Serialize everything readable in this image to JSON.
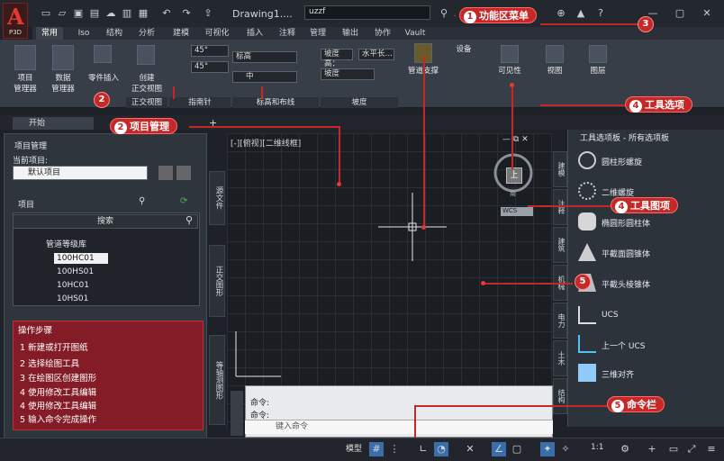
{
  "app": {
    "logo_text": "A",
    "logo_version": "P3D",
    "doc_title": "Drawing1....",
    "search_value": "uzzf"
  },
  "ribbon_tabs": [
    "常用",
    "Iso",
    "结构",
    "分析",
    "建模",
    "可视化",
    "插入",
    "注释",
    "管理",
    "输出",
    "协作",
    "Vault"
  ],
  "ribbon": {
    "project_manager": "项目\n管理器",
    "data_manager": "数据\n管理器",
    "part_insert": "零件插入",
    "create_ortho": "创建\n正交视图",
    "ortho_view_panel": "正交视图",
    "angle_1": "45°",
    "angle_2": "45°",
    "compass_panel": "指南针",
    "elevation_label": "标高",
    "layout_mid": "中",
    "elevation_routing_panel": "标高和布线",
    "slope_high": "坡度高：",
    "slope_level": "水平长…",
    "slope_label": "坡度",
    "slope_panel": "坡度",
    "pipe_support": "管道支撑",
    "equipment": "设备",
    "visibility": "可见性",
    "view": "视图",
    "layer": "图层"
  },
  "doc_tab": "开始",
  "left_panel": {
    "title": "项目管理",
    "current_project_label": "当前项目:",
    "current_project": "默认项目",
    "project_label": "项目",
    "search_placeholder": "搜索",
    "tree_root": "管道等级库",
    "tree_items": [
      "100HC01",
      "100HS01",
      "10HC01",
      "10HS01"
    ],
    "vtabs": [
      "源文件",
      "正交图形",
      "等轴测图形"
    ]
  },
  "steps": {
    "title": "操作步骤",
    "items": [
      "1 新建或打开图纸",
      "2 选择绘图工具",
      "3 在绘图区创建图形",
      "4 使用修改工具编辑",
      "4 使用修改工具编辑",
      "5 输入命令完成操作"
    ]
  },
  "canvas": {
    "view_label": "[-][俯视][二维线框]",
    "viewcube_top": "上",
    "viewcube_south": "南",
    "wcs": "WCS"
  },
  "command": {
    "line1": "命令:",
    "line2": "命令:",
    "placeholder": "键入命令"
  },
  "tool_palette": {
    "title": "工具选项板 - 所有选项板",
    "vtabs": [
      "建模",
      "注释",
      "建筑",
      "机械",
      "电力",
      "土木",
      "结构"
    ],
    "tools": [
      "圆柱形螺旋",
      "二维螺旋",
      "椭圆形圆柱体",
      "平截面圆锥体",
      "平截头棱锥体",
      "UCS",
      "上一个 UCS",
      "三维对齐"
    ]
  },
  "status": {
    "model": "模型",
    "scale": "1:1"
  },
  "callouts": [
    {
      "n": "1",
      "label": "功能区菜单"
    },
    {
      "n": "2",
      "label": "项目管理"
    },
    {
      "n": "3",
      "label": ""
    },
    {
      "n": "4",
      "label": "工具选项"
    },
    {
      "n": "4",
      "label": "工具图项"
    },
    {
      "n": "5",
      "label": "命令栏"
    },
    {
      "n": "2",
      "label": ""
    },
    {
      "n": "5",
      "label": ""
    }
  ],
  "colors": {
    "accent_red": "#c62828",
    "ribbon_bg": "#383e47",
    "canvas_bg": "#1a1d22"
  }
}
